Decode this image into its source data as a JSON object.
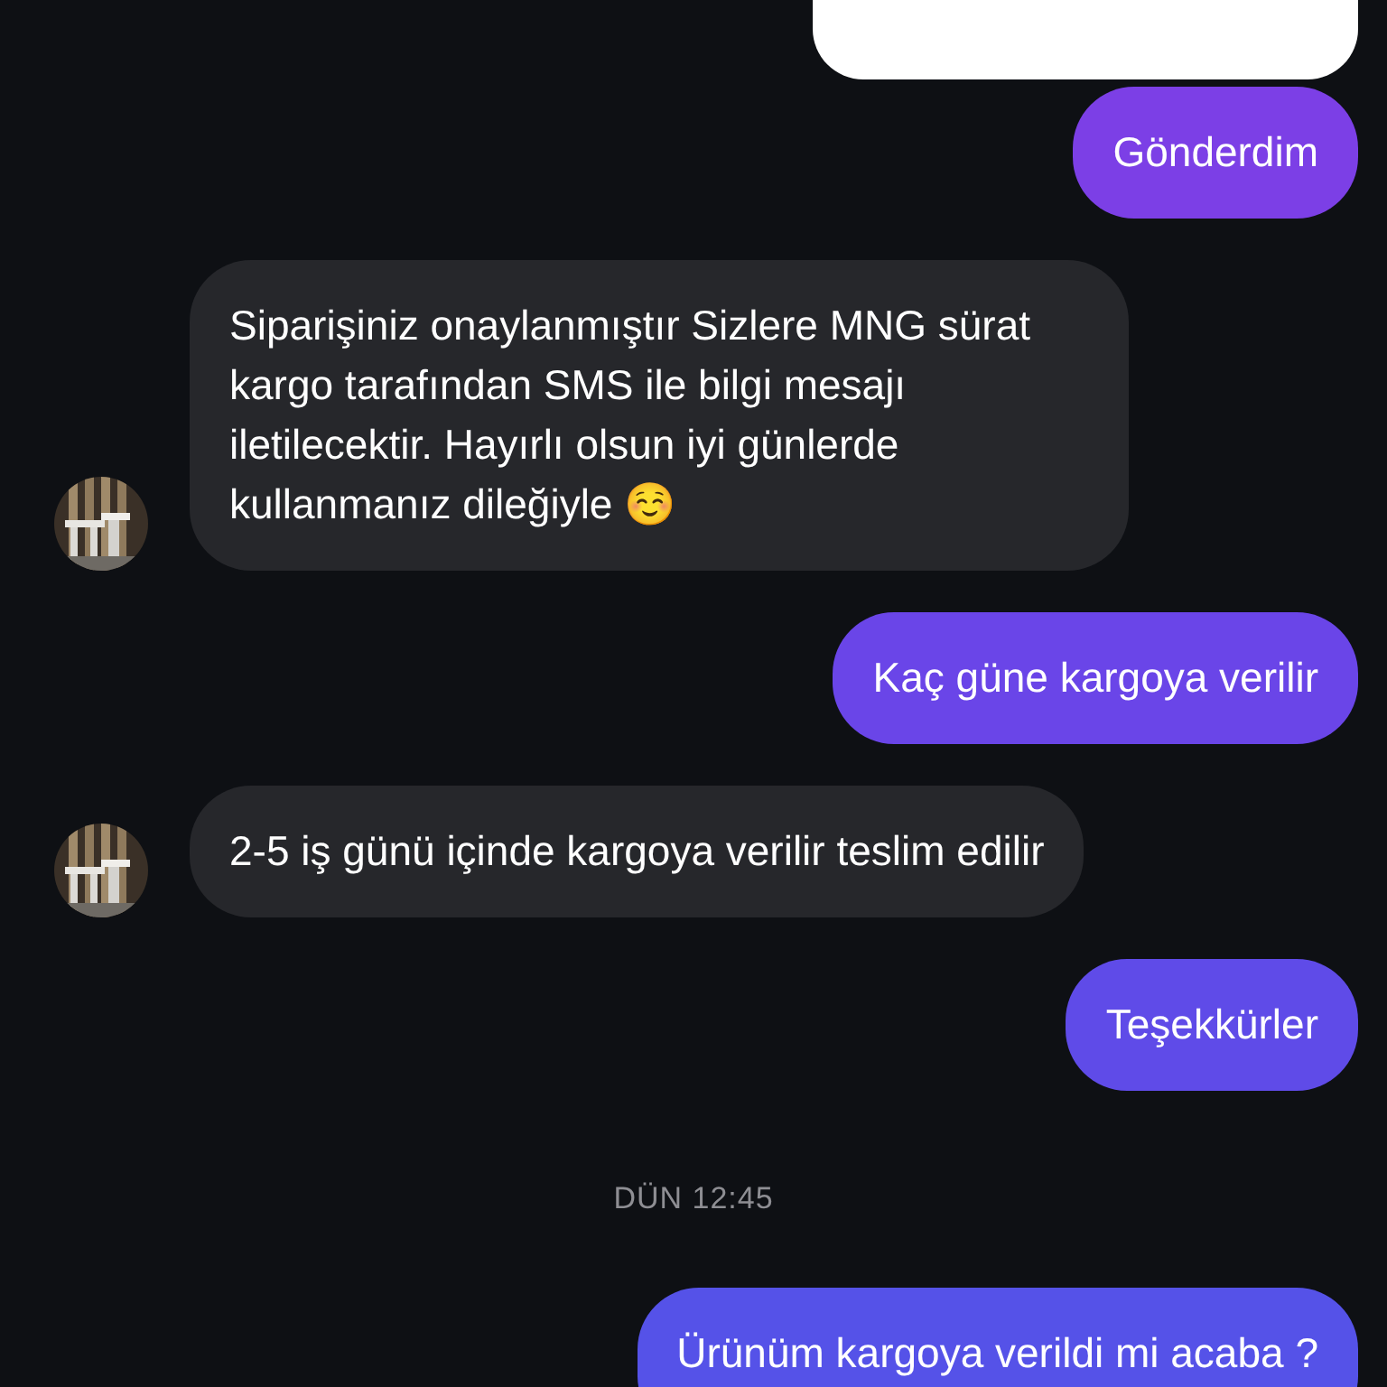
{
  "messages": [
    {
      "kind": "card"
    },
    {
      "kind": "outgoing",
      "text": "Gönderdim",
      "color": "#7c3fe6"
    },
    {
      "kind": "incoming",
      "text": "Siparişiniz onaylanmıştır Sizlere MNG sürat kargo tarafından SMS ile bilgi mesajı iletilecektir. Hayırlı olsun iyi günlerde kullanmanız dileğiyle ☺️",
      "avatar": true
    },
    {
      "kind": "outgoing",
      "text": "Kaç güne kargoya verilir",
      "color": "#6a45e8"
    },
    {
      "kind": "incoming",
      "text": "2-5 iş günü içinde kargoya verilir teslim edilir",
      "avatar": true
    },
    {
      "kind": "outgoing",
      "text": "Teşekkürler",
      "color": "#5f4be8"
    },
    {
      "kind": "timestamp",
      "text": "DÜN 12:45"
    },
    {
      "kind": "outgoing",
      "text": "Ürünüm kargoya verildi mi acaba ?",
      "color": "#5552e8"
    }
  ]
}
